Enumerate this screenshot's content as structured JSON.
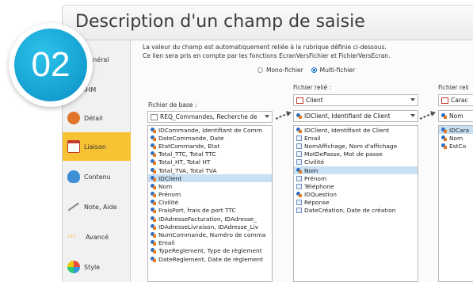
{
  "window": {
    "title": "Description d'un champ de saisie"
  },
  "badge": {
    "number": "02"
  },
  "nav": {
    "items": [
      {
        "label": "Général",
        "icon": "general-icon",
        "active": false
      },
      {
        "label": "IHM",
        "icon": "ihm-icon",
        "active": false
      },
      {
        "label": "Détail",
        "icon": "detail-icon",
        "active": false
      },
      {
        "label": "Liaison",
        "icon": "link-icon",
        "active": true
      },
      {
        "label": "Contenu",
        "icon": "content-icon",
        "active": false
      },
      {
        "label": "Note, Aide",
        "icon": "note-icon",
        "active": false
      },
      {
        "label": "Avancé",
        "icon": "advanced-icon",
        "active": false
      },
      {
        "label": "Style",
        "icon": "style-icon",
        "active": false
      }
    ]
  },
  "description": {
    "line1": "La valeur du champ est automatiquement reliée à la rubrique définie ci-dessous.",
    "line2": "Ce lien sera pris en compte par les fonctions EcranVersFichier et FichierVersEcran."
  },
  "mode": {
    "mono": "Mono-fichier",
    "multi": "Multi-fichier",
    "selected": "multi"
  },
  "base": {
    "label": "Fichier de base :",
    "combo": "REQ_Commandes, Recherche de",
    "rows": [
      "IDCommande, Identifiant de Comm",
      "DateCommande, Date",
      "EtatCommande, Etat",
      "Total_TTC, Total TTC",
      "Total_HT, Total HT",
      "Total_TVA, Total TVA",
      "IDClient",
      "Nom",
      "Prénom",
      "Civilité",
      "FraisPort, frais de port TTC",
      "IDAdresseFacturation, IDAdresse_",
      "IDAdresseLivraison, IDAdresse_Liv",
      "NumCommande, Numéro de comma",
      "Email",
      "TypeReglement, Type de règlement",
      "DateReglement, Date de règlement"
    ],
    "selected_index": 6
  },
  "linked": {
    "label": "Fichier relié :",
    "table_combo": "Client",
    "field_combo": "IDClient, Identifiant de Client",
    "rows": [
      "IDClient, Identifiant de Client",
      "Email",
      "NomAffichage, Nom d'affichage",
      "MotDePasse, Mot de passe",
      "Civilité",
      "Nom",
      "Prénom",
      "Téléphone",
      "IDQuestion",
      "Réponse",
      "DateCréation, Date de création"
    ],
    "selected_index": 5
  },
  "third": {
    "label": "Fichier reli",
    "table_combo": "Carac",
    "field_combo": "Nom",
    "rows": [
      "IDCara",
      "Nom",
      "EstCo"
    ],
    "selected_index": 0
  }
}
